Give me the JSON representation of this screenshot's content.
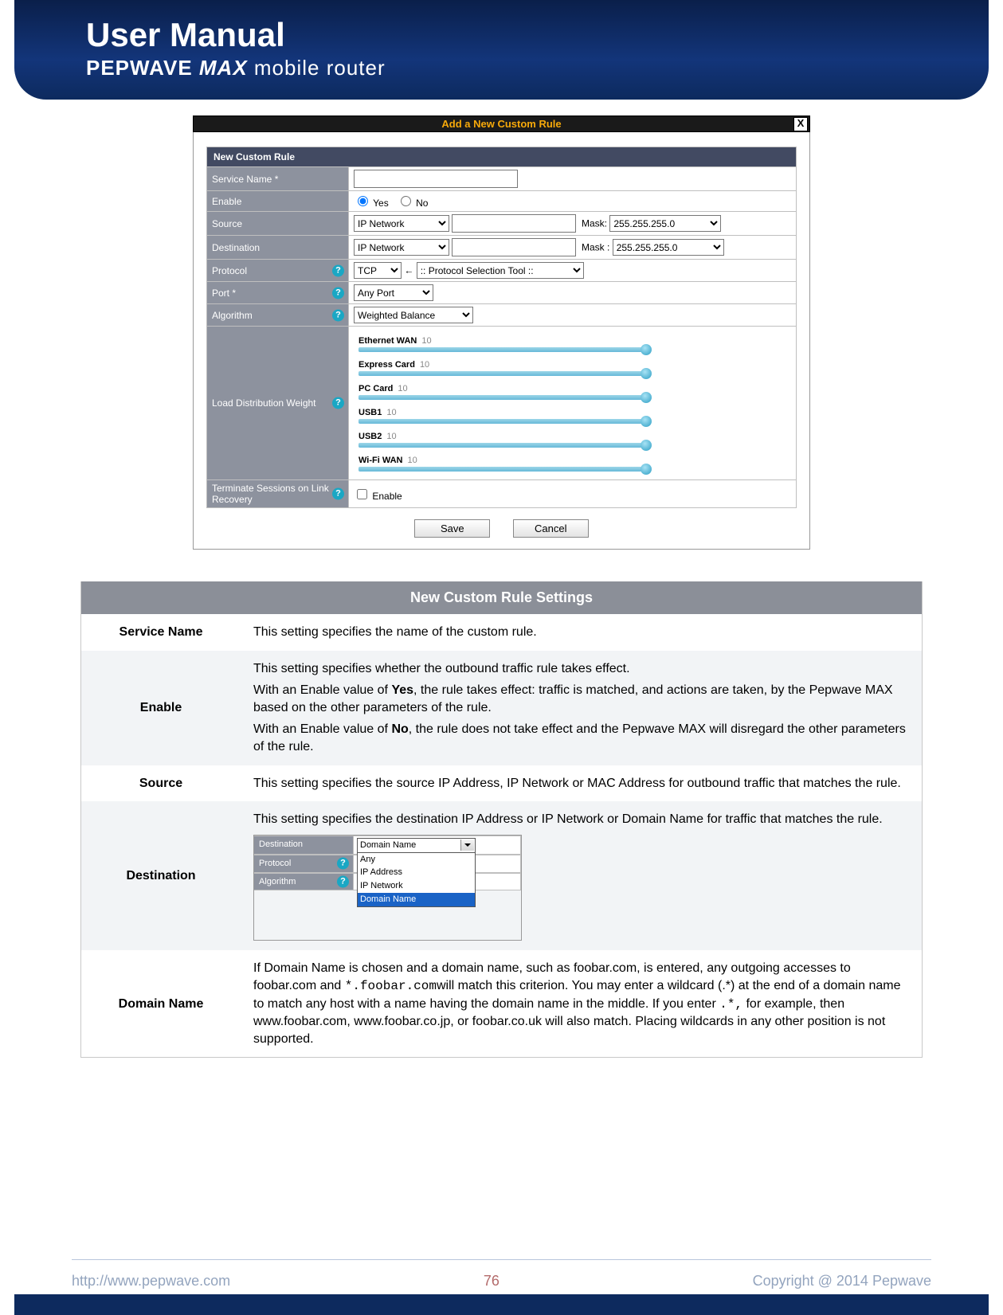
{
  "header": {
    "title": "User Manual",
    "brand_line_prefix": "PEPWAVE ",
    "brand_line_ital": "MAX",
    "brand_line_suffix": " mobile router"
  },
  "dialog": {
    "title": "Add a New Custom Rule",
    "section_header": "New Custom Rule",
    "rows": {
      "service_name": {
        "label": "Service Name *"
      },
      "enable": {
        "label": "Enable",
        "yes": "Yes",
        "no": "No"
      },
      "source": {
        "label": "Source",
        "select": "IP Network",
        "mask_label": "Mask:",
        "mask_value": "255.255.255.0"
      },
      "destination": {
        "label": "Destination",
        "select": "IP Network",
        "mask_label": "Mask :",
        "mask_value": "255.255.255.0"
      },
      "protocol": {
        "label": "Protocol",
        "select": "TCP",
        "arrow": "←",
        "tool": ":: Protocol Selection Tool ::"
      },
      "port": {
        "label": "Port *",
        "select": "Any Port"
      },
      "algorithm": {
        "label": "Algorithm",
        "select": "Weighted Balance"
      },
      "load": {
        "label": "Load Distribution Weight",
        "sliders": [
          {
            "name": "Ethernet WAN",
            "value": "10"
          },
          {
            "name": "Express Card",
            "value": "10"
          },
          {
            "name": "PC Card",
            "value": "10"
          },
          {
            "name": "USB1",
            "value": "10"
          },
          {
            "name": "USB2",
            "value": "10"
          },
          {
            "name": "Wi-Fi WAN",
            "value": "10"
          }
        ]
      },
      "terminate": {
        "label": "Terminate Sessions on Link Recovery",
        "checkbox_label": "Enable"
      }
    },
    "buttons": {
      "save": "Save",
      "cancel": "Cancel"
    }
  },
  "settings": {
    "title": "New Custom Rule Settings",
    "rows": [
      {
        "key": "Service Name",
        "text": "This setting specifies the name of the custom rule."
      },
      {
        "key": "Enable",
        "html": "enable"
      },
      {
        "key": "Source",
        "text": "This setting specifies the source IP Address, IP Network or MAC Address for outbound traffic that matches the rule."
      },
      {
        "key": "Destination",
        "html": "destination"
      },
      {
        "key": "Domain Name",
        "html": "domain"
      }
    ],
    "enable_p1": "This setting specifies whether the outbound traffic rule takes effect.",
    "enable_p2a": "With an Enable value of ",
    "enable_yes": "Yes",
    "enable_p2b": ", the rule takes effect:  traffic is matched, and actions are taken, by the Pepwave MAX based on the other parameters of the rule.",
    "enable_p3a": "With an Enable value of ",
    "enable_no": "No",
    "enable_p3b": ", the rule does not take effect and the Pepwave MAX will disregard the other parameters of the rule.",
    "dest_text": "This setting specifies the destination IP Address or IP Network or Domain Name for traffic that matches the rule.",
    "dest_mini": {
      "rows": [
        {
          "label": "Destination",
          "help": false
        },
        {
          "label": "Protocol",
          "help": true
        },
        {
          "label": "Algorithm",
          "help": true
        }
      ],
      "dd_value": "Domain Name",
      "dd_options": [
        "Any",
        "IP Address",
        "IP Network",
        "Domain Name"
      ]
    },
    "domain_a": "If Domain Name is chosen and a domain name, such as foobar.com, is entered, any outgoing accesses to foobar.com and ",
    "domain_code1": "*.foobar.com",
    "domain_b": "will match this criterion. You may enter a wildcard (.*) at the end of a domain name to match any host with a name having the domain name in the middle. If you enter ",
    "domain_code2": ".*,",
    "domain_c": " for example, then www.foobar.com, www.foobar.co.jp, or foobar.co.uk will also match. Placing wildcards in any other position is not supported."
  },
  "footer": {
    "url": "http://www.pepwave.com",
    "page": "76",
    "copyright": "Copyright @ 2014 Pepwave"
  }
}
